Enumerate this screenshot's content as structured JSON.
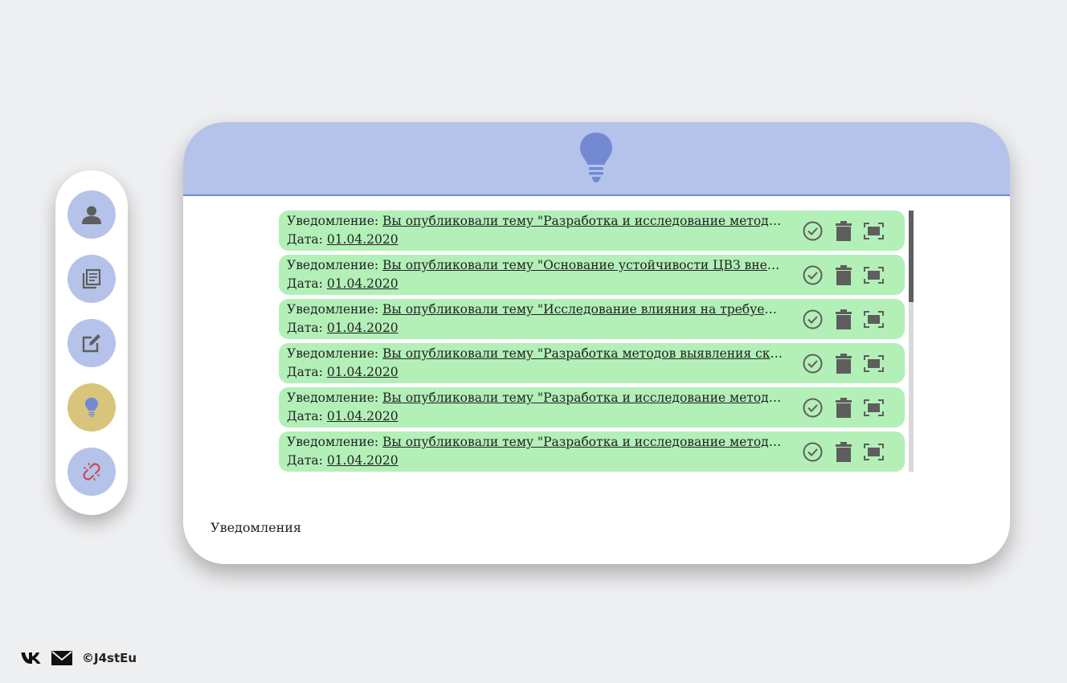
{
  "sidebar": {
    "items": [
      {
        "icon": "user-icon",
        "active": false
      },
      {
        "icon": "documents-icon",
        "active": false
      },
      {
        "icon": "edit-icon",
        "active": false
      },
      {
        "icon": "lightbulb-icon",
        "active": true
      },
      {
        "icon": "broken-link-icon",
        "active": false
      }
    ]
  },
  "header": {
    "icon": "lightbulb-icon"
  },
  "notifications": {
    "label": "Уведомление:",
    "date_label": "Дата:",
    "items": [
      {
        "text": "Вы опубликовали тему \"Разработка и исследование методов оценки эффективности\"",
        "date": "01.04.2020"
      },
      {
        "text": "Вы опубликовали тему \"Основание устойчивости ЦВЗ внедряемых в изображения\"",
        "date": "01.04.2020"
      },
      {
        "text": "Вы опубликовали тему \"Исследование влияния на требуемую пропускную способность\"",
        "date": "01.04.2020"
      },
      {
        "text": "Вы опубликовали тему \"Разработка методов выявления скрытых каналов\"",
        "date": "01.04.2020"
      },
      {
        "text": "Вы опубликовали тему \"Разработка и исследование методов оценки эффективности\"",
        "date": "01.04.2020"
      },
      {
        "text": "Вы опубликовали тему \"Разработка и исследование методов оценки эффективности\"",
        "date": "01.04.2020"
      }
    ],
    "actions": [
      "check-circle-icon",
      "trash-icon",
      "expand-icon"
    ]
  },
  "card_title": "Уведомления",
  "footer": {
    "icons": [
      "vk-icon",
      "mail-icon"
    ],
    "copyright": "©J4stEu"
  },
  "colors": {
    "background": "#eeeff1",
    "header": "#b5c3ea",
    "accent": "#7389d4",
    "notification": "#b3f0b8",
    "active_button": "#d8c47a"
  }
}
